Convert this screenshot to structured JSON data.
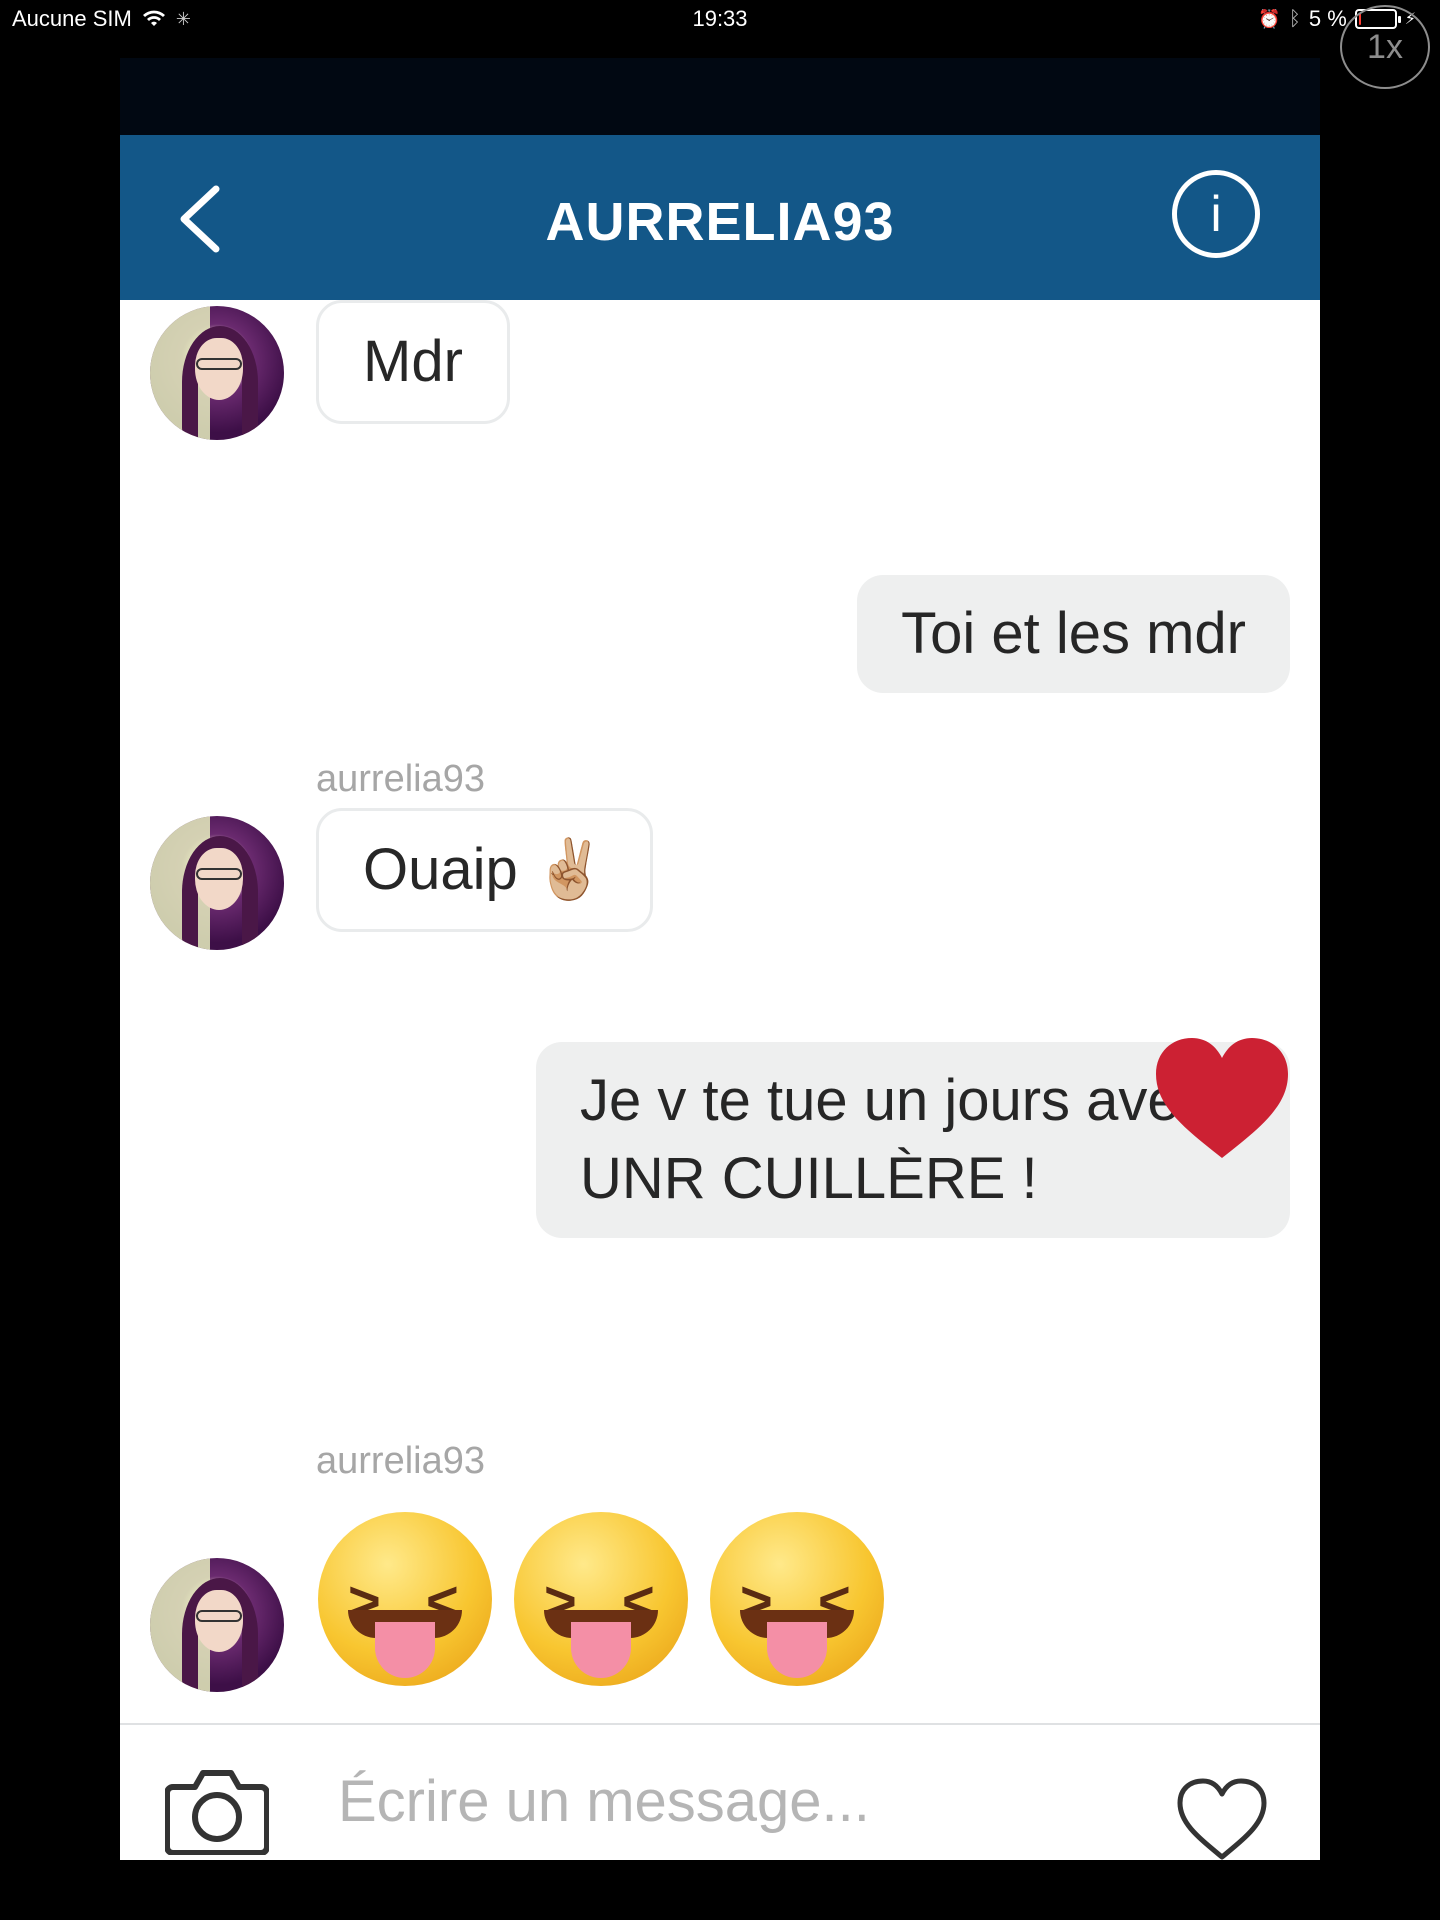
{
  "status_bar": {
    "carrier": "Aucune SIM",
    "time": "19:33",
    "battery_text": "5 %",
    "battery_level": 0.05
  },
  "zoom_badge": "1x",
  "header": {
    "title": "AURRELIA93",
    "info_glyph": "i"
  },
  "messages": [
    {
      "side": "in",
      "text": "Mdr"
    },
    {
      "side": "out",
      "text": "Toi et les mdr"
    },
    {
      "side": "in",
      "sender": "aurrelia93",
      "text": "Ouaip ✌🏼"
    },
    {
      "side": "out",
      "line1": "Je v te tue un jours avec",
      "line2": "UNR CUILLÈRE !"
    },
    {
      "side": "out",
      "type": "heart"
    },
    {
      "side": "in",
      "sender": "aurrelia93",
      "type": "emoji",
      "count": 3
    }
  ],
  "composer": {
    "placeholder": "Écrire un message..."
  },
  "icons": {
    "back": "chevron-left-icon",
    "info": "info-icon",
    "camera": "camera-icon",
    "like": "heart-outline-icon",
    "sent_like": "heart-filled-icon"
  },
  "colors": {
    "nav": "#135788",
    "heart": "#cc2133",
    "outgoing_bubble": "#eeefef"
  }
}
